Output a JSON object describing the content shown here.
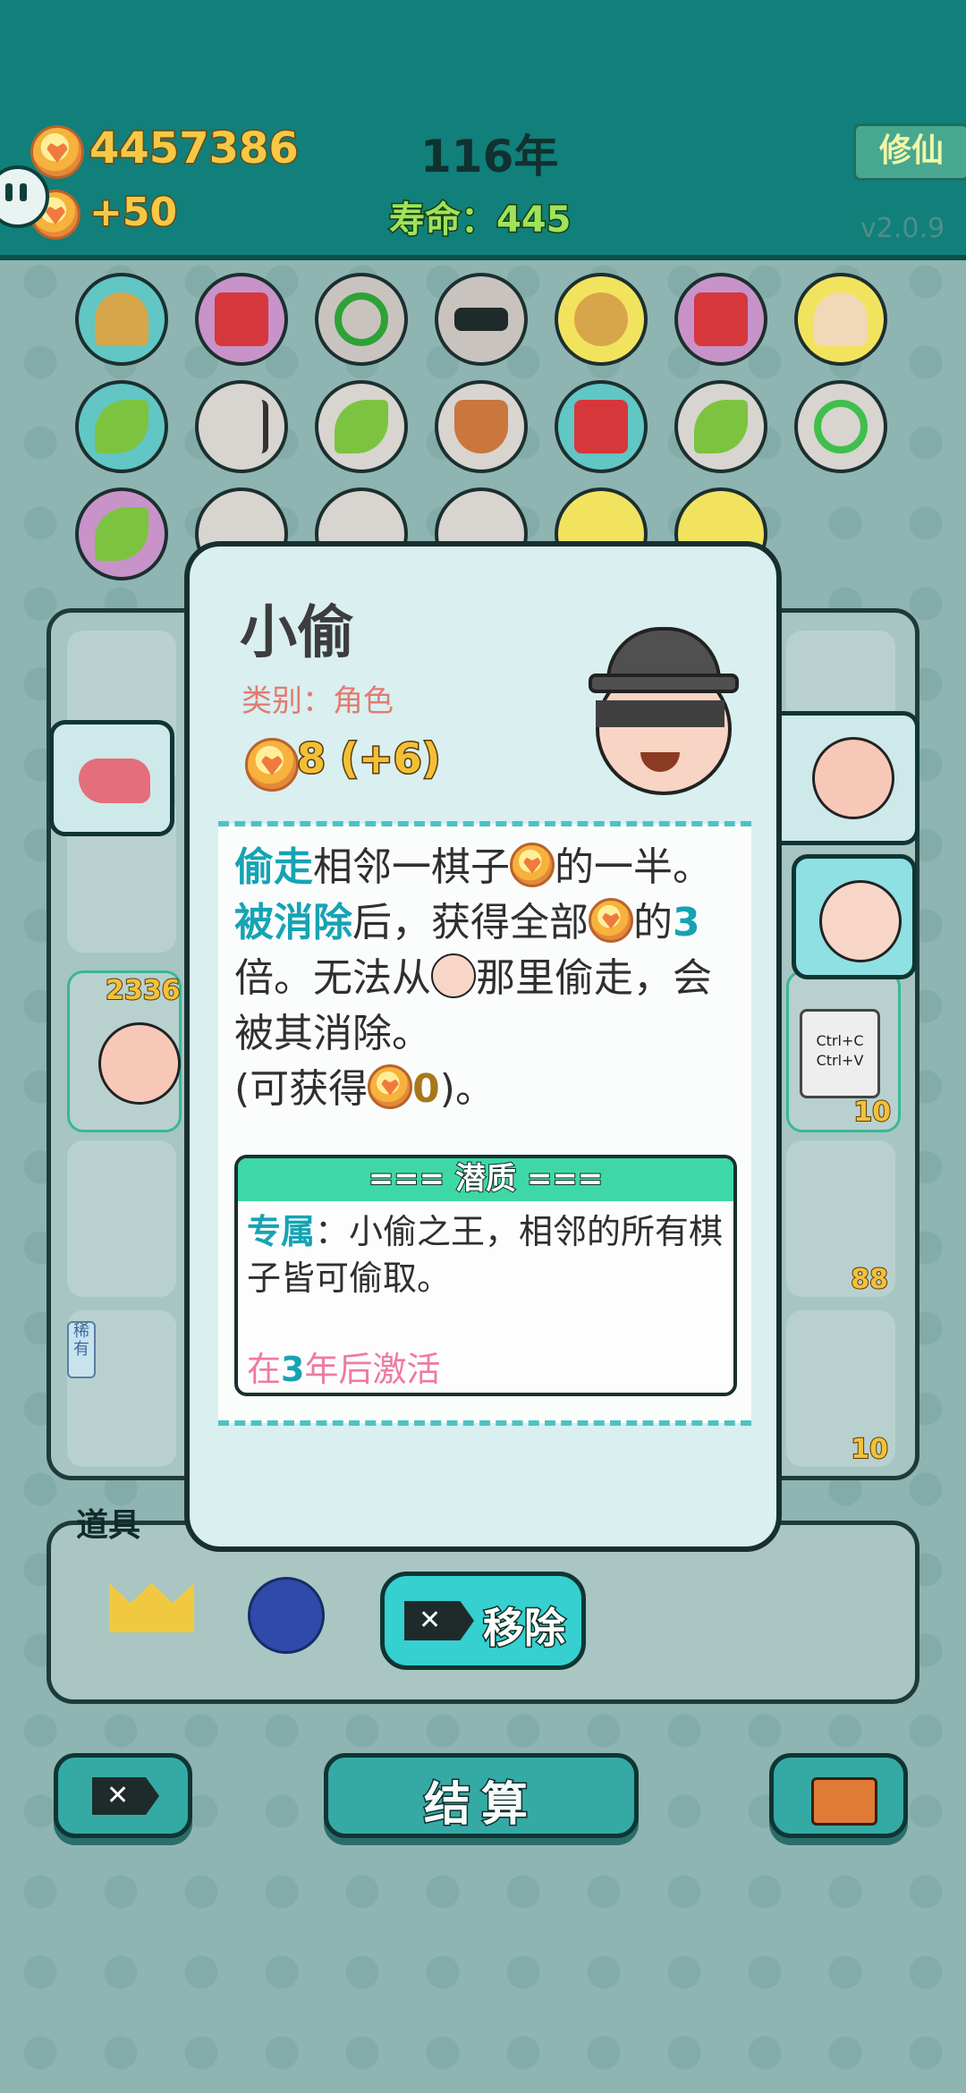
{
  "header": {
    "coins": "4457386",
    "income": "+50",
    "year": "116年",
    "lifespan": "寿命：445",
    "mode_button": "修仙",
    "version": "v2.0.9"
  },
  "board": {
    "counts": [
      "2336",
      "10",
      "88",
      "10"
    ],
    "rarity_tag": "稀有",
    "card_text_1": "Ctrl+C",
    "card_text_2": "Ctrl+V"
  },
  "popup": {
    "title": "小偷",
    "category": "类别：角色",
    "cost": "8 (+6)",
    "desc": {
      "part1": "偷走",
      "part2": "相邻一棋子",
      "part3": "的一半。",
      "part4": "被消除",
      "part5": "后，获得全部",
      "part6": "的",
      "part7": "3",
      "part8": "倍。无法从",
      "part9": "那里偷走，会被其消除。",
      "part10": "(可获得",
      "part11": "0",
      "part12": ")。"
    },
    "trait": {
      "header": "=== 潜质 ===",
      "label": "专属",
      "text": "：小偷之王，相邻的所有棋子皆可偷取。",
      "activate_pre": "在",
      "activate_num": "3",
      "activate_post": "年后激活"
    }
  },
  "tools": {
    "label": "道具"
  },
  "buttons": {
    "remove": "移除",
    "settle": "结算"
  }
}
